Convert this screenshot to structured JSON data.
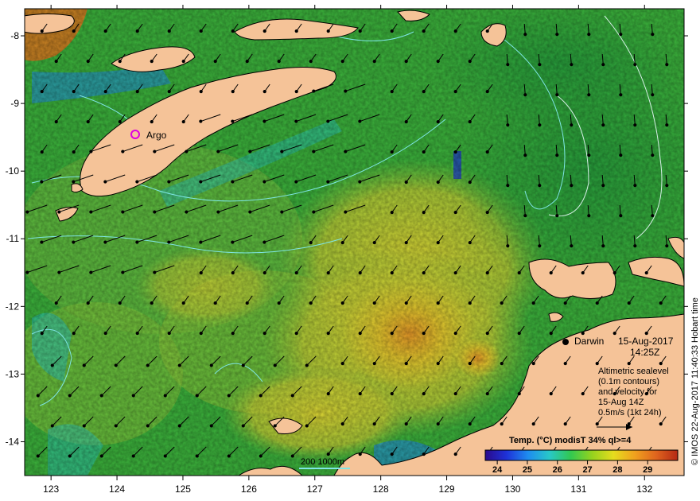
{
  "map": {
    "x_ticks": [
      "123",
      "124",
      "125",
      "126",
      "127",
      "128",
      "129",
      "130",
      "131",
      "132"
    ],
    "y_ticks": [
      "-8",
      "-9",
      "-10",
      "-11",
      "-12",
      "-13",
      "-14"
    ],
    "lon_range": [
      122.6,
      132.6
    ],
    "lat_range": [
      -7.6,
      -14.5
    ],
    "argo_label": "Argo",
    "city": "Darwin",
    "date": "15-Aug-2017",
    "time": "14:25Z",
    "info_lines": [
      "Altimetric sealevel",
      "(0.1m contours)",
      "and velocity for",
      "15-Aug 14Z",
      "0.5m/s (1kt 24h)"
    ],
    "scale_bar": "200  1000m",
    "credit": "© IMOS 22-Aug-2017 11:40:33 Hobart time"
  },
  "colorbar": {
    "title": "Temp. (°C) modisT 34% ql>=4",
    "ticks": [
      "24",
      "25",
      "26",
      "27",
      "28",
      "29"
    ],
    "range": [
      23.6,
      30.0
    ],
    "colors": [
      "#2a0a8c",
      "#1e32d8",
      "#1e8cf0",
      "#28c8c8",
      "#32c850",
      "#96d21e",
      "#e6dc1e",
      "#f0a01e",
      "#e0641e",
      "#b42814"
    ]
  },
  "colors": {
    "land": "#f5c398",
    "ocean_green": "#3cb43c",
    "ocean_yellow": "#e6d232",
    "contour": "#7fe6e6"
  }
}
